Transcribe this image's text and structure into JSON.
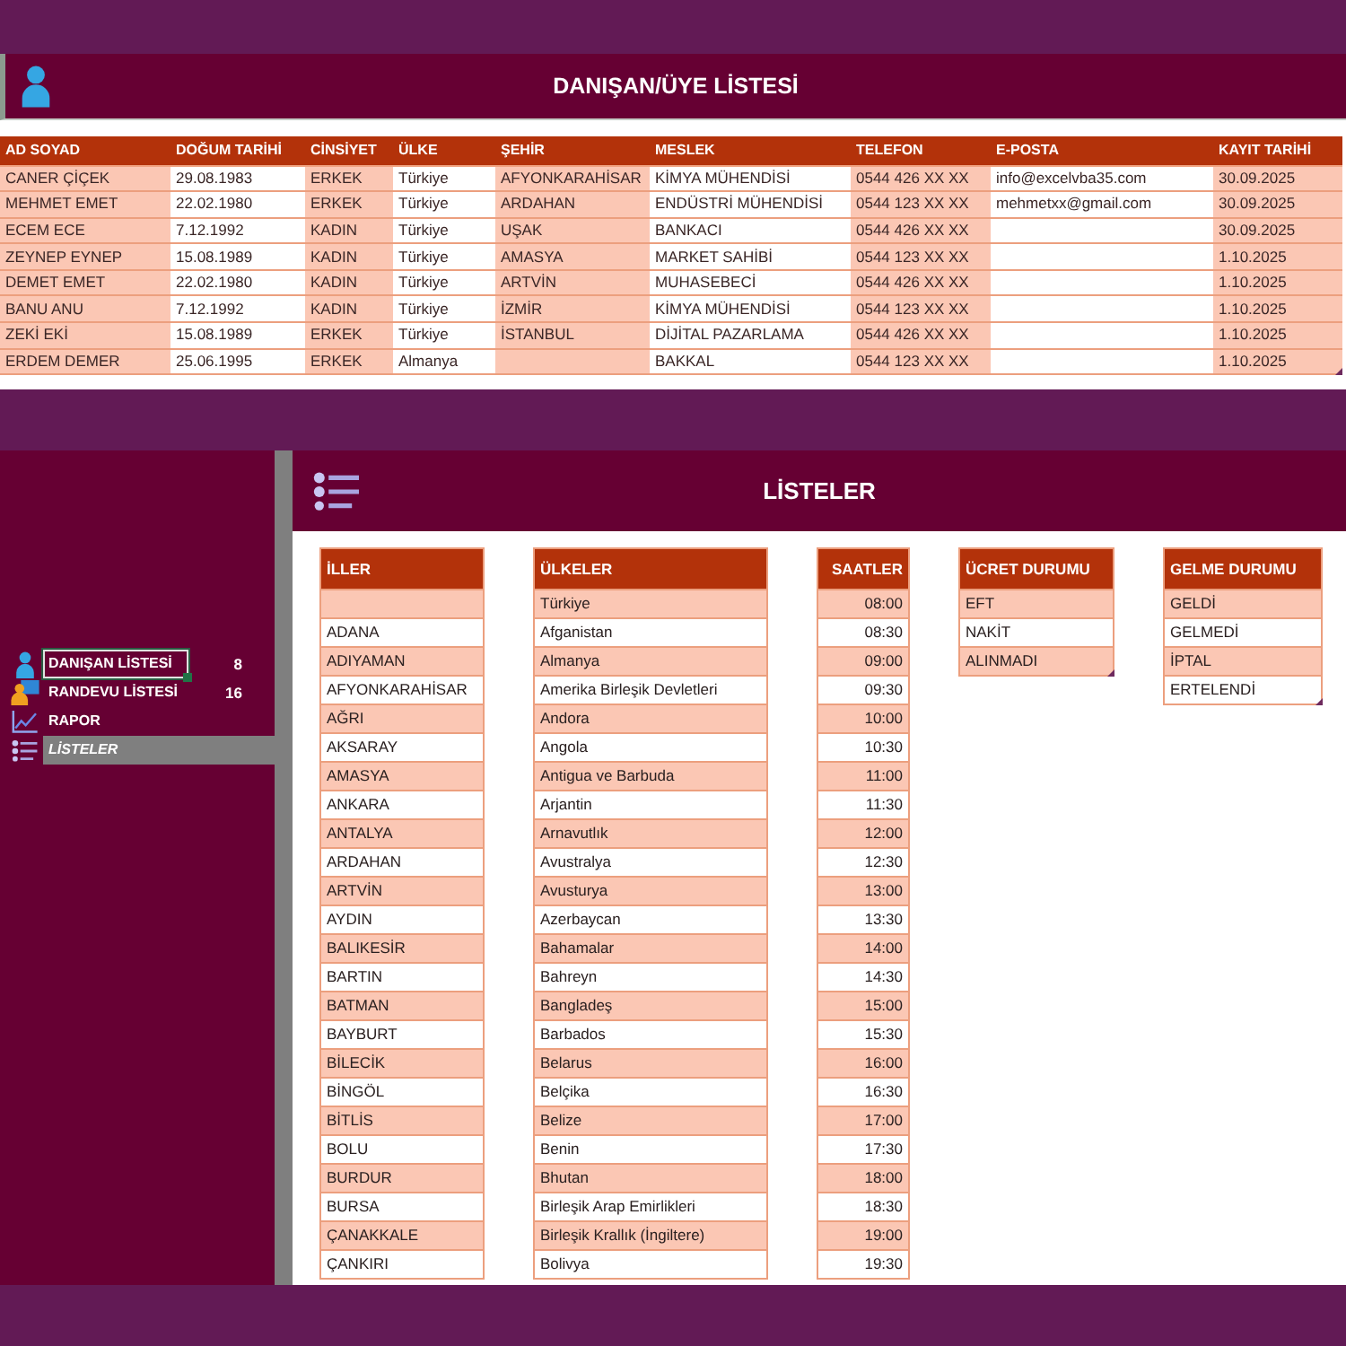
{
  "client_list": {
    "title": "DANIŞAN/ÜYE LİSTESİ",
    "table": {
      "columns": [
        "AD SOYAD",
        "DOĞUM TARİHİ",
        "CİNSİYET",
        "ÜLKE",
        "ŞEHİR",
        "MESLEK",
        "TELEFON",
        "E-POSTA",
        "KAYIT TARİHİ"
      ],
      "resize_handle": true,
      "rows": [
        [
          "CANER ÇİÇEK",
          "29.08.1983",
          "ERKEK",
          "Türkiye",
          "AFYONKARAHİSAR",
          "KİMYA MÜHENDİSİ",
          "0544 426 XX XX",
          "info@excelvba35.com",
          "30.09.2025"
        ],
        [
          "MEHMET EMET",
          "22.02.1980",
          "ERKEK",
          "Türkiye",
          "ARDAHAN",
          "ENDÜSTRİ MÜHENDİSİ",
          "0544 123 XX XX",
          "mehmetxx@gmail.com",
          "30.09.2025"
        ],
        [
          "ECEM ECE",
          "7.12.1992",
          "KADIN",
          "Türkiye",
          "UŞAK",
          "BANKACI",
          "0544 426 XX XX",
          null,
          "30.09.2025"
        ],
        [
          "ZEYNEP EYNEP",
          "15.08.1989",
          "KADIN",
          "Türkiye",
          "AMASYA",
          "MARKET SAHİBİ",
          "0544 123 XX XX",
          null,
          "1.10.2025"
        ],
        [
          "DEMET EMET",
          "22.02.1980",
          "KADIN",
          "Türkiye",
          "ARTVİN",
          "MUHASEBECİ",
          "0544 426 XX XX",
          null,
          "1.10.2025"
        ],
        [
          "BANU ANU",
          "7.12.1992",
          "KADIN",
          "Türkiye",
          "İZMİR",
          "KİMYA MÜHENDİSİ",
          "0544 123 XX XX",
          null,
          "1.10.2025"
        ],
        [
          "ZEKİ EKİ",
          "15.08.1989",
          "ERKEK",
          "Türkiye",
          "İSTANBUL",
          "DİJİTAL PAZARLAMA",
          "0544 426 XX XX",
          null,
          "1.10.2025"
        ],
        [
          "ERDEM DEMER",
          "25.06.1995",
          "ERKEK",
          "Almanya",
          null,
          "BAKKAL",
          "0544 123 XX XX",
          null,
          "1.10.2025"
        ]
      ]
    }
  },
  "sidebar": {
    "items": [
      {
        "label": "DANIŞAN LİSTESİ",
        "count": "8",
        "selected": false,
        "focused": true
      },
      {
        "label": "RANDEVU LİSTESİ",
        "count": "16",
        "selected": false,
        "focused": false
      },
      {
        "label": "RAPOR",
        "selected": false,
        "focused": false
      },
      {
        "label": "LİSTELER",
        "selected": true,
        "focused": false
      }
    ]
  },
  "lists_panel": {
    "title": "LİSTELER",
    "lists": [
      {
        "title": "İLLER",
        "kind": "text",
        "resize_handle": false,
        "rows": [
          null,
          "ADANA",
          "ADIYAMAN",
          "AFYONKARAHİSAR",
          "AĞRI",
          "AKSARAY",
          "AMASYA",
          "ANKARA",
          "ANTALYA",
          "ARDAHAN",
          "ARTVİN",
          "AYDIN",
          "BALIKESİR",
          "BARTIN",
          "BATMAN",
          "BAYBURT",
          "BİLECİK",
          "BİNGÖL",
          "BİTLİS",
          "BOLU",
          "BURDUR",
          "BURSA",
          "ÇANAKKALE",
          "ÇANKIRI"
        ]
      },
      {
        "title": "ÜLKELER",
        "kind": "text",
        "resize_handle": false,
        "rows": [
          "Türkiye",
          "Afganistan",
          "Almanya",
          "Amerika Birleşik Devletleri",
          "Andora",
          "Angola",
          "Antigua ve Barbuda",
          "Arjantin",
          "Arnavutlık",
          "Avustralya",
          "Avusturya",
          "Azerbaycan",
          "Bahamalar",
          "Bahreyn",
          "Bangladeş",
          "Barbados",
          "Belarus",
          "Belçika",
          "Belize",
          "Benin",
          "Bhutan",
          "Birleşik Arap Emirlikleri",
          "Birleşik Krallık (İngiltere)",
          "Bolivya"
        ]
      },
      {
        "title": "SAATLER",
        "kind": "time",
        "resize_handle": false,
        "rows": [
          "08:00",
          "08:30",
          "09:00",
          "09:30",
          "10:00",
          "10:30",
          "11:00",
          "11:30",
          "12:00",
          "12:30",
          "13:00",
          "13:30",
          "14:00",
          "14:30",
          "15:00",
          "15:30",
          "16:00",
          "16:30",
          "17:00",
          "17:30",
          "18:00",
          "18:30",
          "19:00",
          "19:30"
        ]
      },
      {
        "title": "ÜCRET DURUMU",
        "kind": "text",
        "resize_handle": true,
        "rows": [
          "EFT",
          "NAKİT",
          "ALINMADI"
        ]
      },
      {
        "title": "GELME DURUMU",
        "kind": "text",
        "resize_handle": true,
        "rows": [
          "GELDİ",
          "GELMEDİ",
          "İPTAL",
          "ERTELENDİ"
        ]
      }
    ]
  }
}
